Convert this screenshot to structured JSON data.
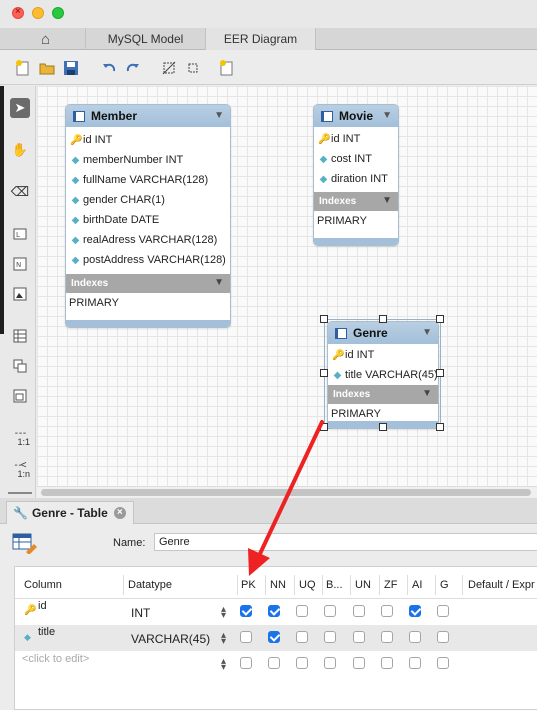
{
  "tabs": {
    "mysql_model": "MySQL Model",
    "eer_diagram": "EER Diagram"
  },
  "diagram": {
    "member": {
      "title": "Member",
      "columns": [
        {
          "name": "id INT",
          "key": "pk"
        },
        {
          "name": "memberNumber INT",
          "key": "col"
        },
        {
          "name": "fullName VARCHAR(128)",
          "key": "col"
        },
        {
          "name": "gender CHAR(1)",
          "key": "col"
        },
        {
          "name": "birthDate DATE",
          "key": "col"
        },
        {
          "name": "realAdress VARCHAR(128)",
          "key": "col"
        },
        {
          "name": "postAddress VARCHAR(128)",
          "key": "col"
        }
      ],
      "indexes_label": "Indexes",
      "index": "PRIMARY"
    },
    "movie": {
      "title": "Movie",
      "columns": [
        {
          "name": "id INT",
          "key": "pk"
        },
        {
          "name": "cost INT",
          "key": "col"
        },
        {
          "name": "diration INT",
          "key": "col"
        }
      ],
      "indexes_label": "Indexes",
      "index": "PRIMARY"
    },
    "genre": {
      "title": "Genre",
      "columns": [
        {
          "name": "id INT",
          "key": "pk"
        },
        {
          "name": "title VARCHAR(45)",
          "key": "col"
        }
      ],
      "indexes_label": "Indexes",
      "index": "PRIMARY"
    }
  },
  "sidebar_labels": {
    "one_to_one": "1:1",
    "one_to_n": "1:n"
  },
  "editor": {
    "tab_title": "Genre - Table",
    "name_label": "Name:",
    "name_value": "Genre",
    "headers": {
      "column": "Column",
      "datatype": "Datatype",
      "pk": "PK",
      "nn": "NN",
      "uq": "UQ",
      "b": "B...",
      "un": "UN",
      "zf": "ZF",
      "ai": "AI",
      "g": "G",
      "default": "Default / Expr"
    },
    "rows": [
      {
        "name": "id",
        "key": "pk",
        "datatype": "INT",
        "pk": true,
        "nn": true,
        "uq": false,
        "b": false,
        "un": false,
        "zf": false,
        "ai": true,
        "g": false
      },
      {
        "name": "title",
        "key": "col",
        "datatype": "VARCHAR(45)",
        "pk": false,
        "nn": true,
        "uq": false,
        "b": false,
        "un": false,
        "zf": false,
        "ai": false,
        "g": false
      }
    ],
    "placeholder": "<click to edit>"
  },
  "colors": {
    "annotation_arrow": "#ee2222",
    "checkbox_on": "#1a73e8",
    "table_header": "#a3bfd9"
  }
}
